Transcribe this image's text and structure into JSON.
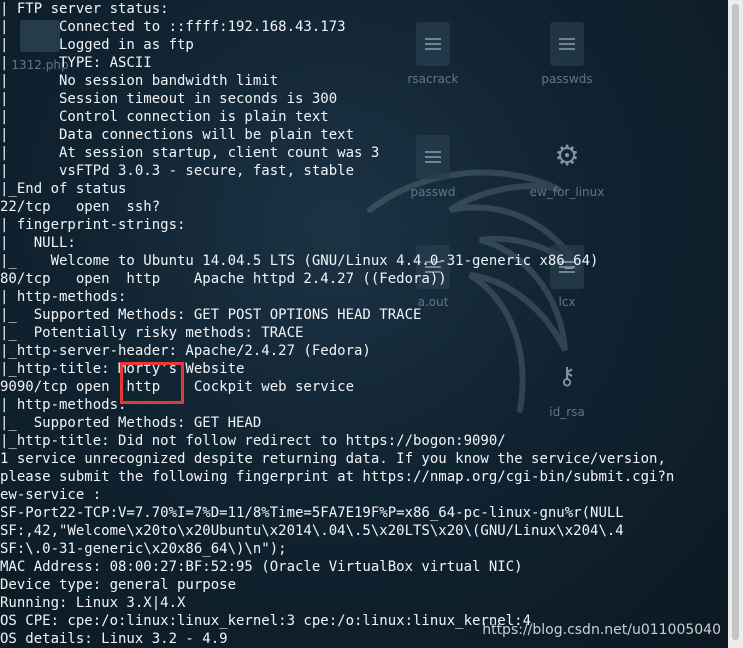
{
  "terminal": {
    "lines": [
      "| FTP server status:",
      "|      Connected to ::ffff:192.168.43.173",
      "|      Logged in as ftp",
      "|      TYPE: ASCII",
      "|      No session bandwidth limit",
      "|      Session timeout in seconds is 300",
      "|      Control connection is plain text",
      "|      Data connections will be plain text",
      "|      At session startup, client count was 3",
      "|      vsFTPd 3.0.3 - secure, fast, stable",
      "|_End of status",
      "22/tcp   open  ssh?",
      "| fingerprint-strings:",
      "|   NULL:",
      "|_    Welcome to Ubuntu 14.04.5 LTS (GNU/Linux 4.4.0-31-generic x86_64)",
      "80/tcp   open  http    Apache httpd 2.4.27 ((Fedora))",
      "| http-methods:",
      "|_  Supported Methods: GET POST OPTIONS HEAD TRACE",
      "|_  Potentially risky methods: TRACE",
      "|_http-server-header: Apache/2.4.27 (Fedora)",
      "|_http-title: Morty's Website",
      "9090/tcp open  http    Cockpit web service",
      "| http-methods:",
      "|_  Supported Methods: GET HEAD",
      "|_http-title: Did not follow redirect to https://bogon:9090/",
      "1 service unrecognized despite returning data. If you know the service/version,",
      "please submit the following fingerprint at https://nmap.org/cgi-bin/submit.cgi?n",
      "ew-service :",
      "SF-Port22-TCP:V=7.70%I=7%D=11/8%Time=5FA7E19F%P=x86_64-pc-linux-gnu%r(NULL",
      "SF:,42,\"Welcome\\x20to\\x20Ubuntu\\x2014\\.04\\.5\\x20LTS\\x20\\(GNU/Linux\\x204\\.4",
      "SF:\\.0-31-generic\\x20x86_64\\)\\n\");",
      "MAC Address: 08:00:27:BF:52:95 (Oracle VirtualBox virtual NIC)",
      "Device type: general purpose",
      "Running: Linux 3.X|4.X",
      "OS CPE: cpe:/o:linux:linux_kernel:3 cpe:/o:linux:linux_kernel:4",
      "OS details: Linux 3.2 - 4.9"
    ]
  },
  "desktop_icons": [
    {
      "label": "1312.php",
      "icon": "folder-icon"
    },
    {
      "label": "rsacrack",
      "icon": "document-icon"
    },
    {
      "label": "passwds",
      "icon": "document-icon"
    },
    {
      "label": "passwd",
      "icon": "document-icon"
    },
    {
      "label": "ew_for_linux",
      "icon": "gear-icon"
    },
    {
      "label": "a.out",
      "icon": "document-icon"
    },
    {
      "label": "lcx",
      "icon": "document-icon"
    },
    {
      "label": "id_rsa",
      "icon": "key-icon"
    }
  ],
  "watermark": "https://blog.csdn.net/u011005040",
  "colors": {
    "background": "#102331",
    "text": "#f2f5f7",
    "highlight_box": "#e53935"
  }
}
